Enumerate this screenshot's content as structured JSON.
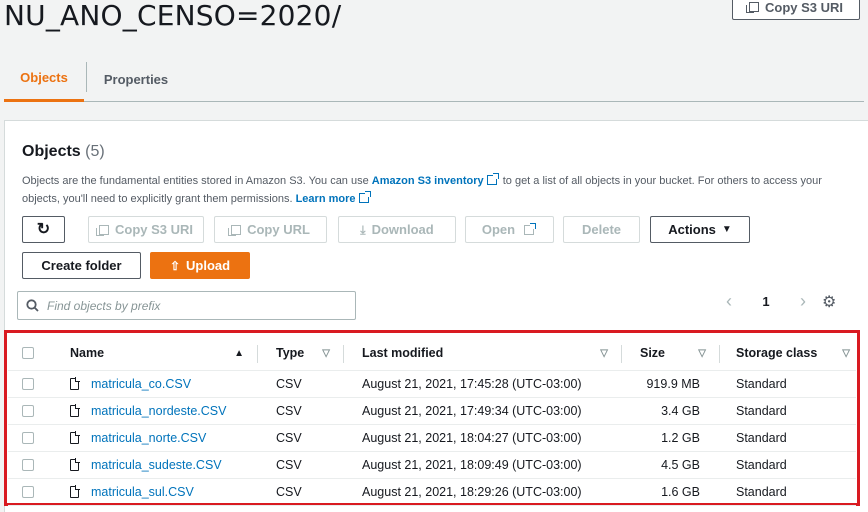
{
  "header": {
    "title": "NU_ANO_CENSO=2020/",
    "copy_s3_uri_label": "Copy S3 URI"
  },
  "tabs": [
    {
      "label": "Objects",
      "active": true
    },
    {
      "label": "Properties",
      "active": false
    }
  ],
  "objects_panel": {
    "heading": "Objects",
    "count": "(5)",
    "description_part1": "Objects are the fundamental entities stored in Amazon S3. You can use",
    "inventory_link": "Amazon S3 inventory",
    "description_part2": "to get a list of all objects in your bucket. For others to access your objects, you'll need to explicitly grant them permissions.",
    "learn_more_link": "Learn more"
  },
  "toolbar": {
    "refresh_icon": "refresh-icon",
    "copy_s3_uri": "Copy S3 URI",
    "copy_url": "Copy URL",
    "download": "Download",
    "open": "Open",
    "delete": "Delete",
    "actions": "Actions",
    "create_folder": "Create folder",
    "upload": "Upload"
  },
  "search": {
    "placeholder": "Find objects by prefix"
  },
  "pagination": {
    "current_page": "1"
  },
  "table": {
    "columns": [
      "Name",
      "Type",
      "Last modified",
      "Size",
      "Storage class"
    ],
    "rows": [
      {
        "name": "matricula_co.CSV",
        "type": "CSV",
        "modified": "August 21, 2021, 17:45:28 (UTC-03:00)",
        "size": "919.9 MB",
        "storage": "Standard"
      },
      {
        "name": "matricula_nordeste.CSV",
        "type": "CSV",
        "modified": "August 21, 2021, 17:49:34 (UTC-03:00)",
        "size": "3.4 GB",
        "storage": "Standard"
      },
      {
        "name": "matricula_norte.CSV",
        "type": "CSV",
        "modified": "August 21, 2021, 18:04:27 (UTC-03:00)",
        "size": "1.2 GB",
        "storage": "Standard"
      },
      {
        "name": "matricula_sudeste.CSV",
        "type": "CSV",
        "modified": "August 21, 2021, 18:09:49 (UTC-03:00)",
        "size": "4.5 GB",
        "storage": "Standard"
      },
      {
        "name": "matricula_sul.CSV",
        "type": "CSV",
        "modified": "August 21, 2021, 18:29:26 (UTC-03:00)",
        "size": "1.6 GB",
        "storage": "Standard"
      }
    ]
  },
  "colors": {
    "accent": "#ec7211",
    "link": "#0073bb",
    "highlight": "#d91a21"
  }
}
